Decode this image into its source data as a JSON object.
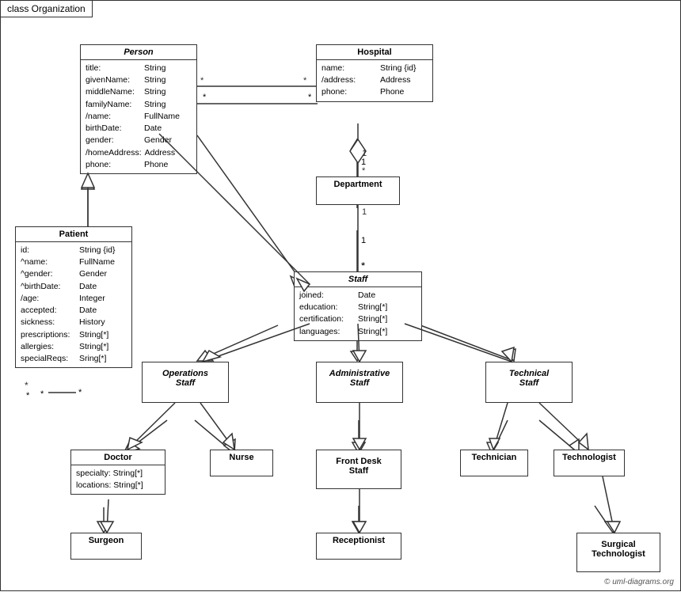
{
  "title": "class Organization",
  "copyright": "© uml-diagrams.org",
  "classes": {
    "person": {
      "name": "Person",
      "italic": true,
      "attrs": [
        [
          "title:",
          "String"
        ],
        [
          "givenName:",
          "String"
        ],
        [
          "middleName:",
          "String"
        ],
        [
          "familyName:",
          "String"
        ],
        [
          "/name:",
          "FullName"
        ],
        [
          "birthDate:",
          "Date"
        ],
        [
          "gender:",
          "Gender"
        ],
        [
          "/homeAddress:",
          "Address"
        ],
        [
          "phone:",
          "Phone"
        ]
      ]
    },
    "hospital": {
      "name": "Hospital",
      "italic": false,
      "attrs": [
        [
          "name:",
          "String {id}"
        ],
        [
          "/address:",
          "Address"
        ],
        [
          "phone:",
          "Phone"
        ]
      ]
    },
    "patient": {
      "name": "Patient",
      "italic": false,
      "attrs": [
        [
          "id:",
          "String {id}"
        ],
        [
          "^name:",
          "FullName"
        ],
        [
          "^gender:",
          "Gender"
        ],
        [
          "^birthDate:",
          "Date"
        ],
        [
          "/age:",
          "Integer"
        ],
        [
          "accepted:",
          "Date"
        ],
        [
          "sickness:",
          "History"
        ],
        [
          "prescriptions:",
          "String[*]"
        ],
        [
          "allergies:",
          "String[*]"
        ],
        [
          "specialReqs:",
          "Sring[*]"
        ]
      ]
    },
    "department": {
      "name": "Department",
      "italic": false,
      "attrs": []
    },
    "staff": {
      "name": "Staff",
      "italic": true,
      "attrs": [
        [
          "joined:",
          "Date"
        ],
        [
          "education:",
          "String[*]"
        ],
        [
          "certification:",
          "String[*]"
        ],
        [
          "languages:",
          "String[*]"
        ]
      ]
    },
    "operations_staff": {
      "name": "Operations\nStaff",
      "italic": true,
      "attrs": []
    },
    "administrative_staff": {
      "name": "Administrative\nStaff",
      "italic": true,
      "attrs": []
    },
    "technical_staff": {
      "name": "Technical\nStaff",
      "italic": true,
      "attrs": []
    },
    "doctor": {
      "name": "Doctor",
      "italic": false,
      "attrs": [
        [
          "specialty:",
          "String[*]"
        ],
        [
          "locations:",
          "String[*]"
        ]
      ]
    },
    "nurse": {
      "name": "Nurse",
      "italic": false,
      "attrs": []
    },
    "front_desk_staff": {
      "name": "Front Desk\nStaff",
      "italic": false,
      "attrs": []
    },
    "technician": {
      "name": "Technician",
      "italic": false,
      "attrs": []
    },
    "technologist": {
      "name": "Technologist",
      "italic": false,
      "attrs": []
    },
    "surgeon": {
      "name": "Surgeon",
      "italic": false,
      "attrs": []
    },
    "receptionist": {
      "name": "Receptionist",
      "italic": false,
      "attrs": []
    },
    "surgical_technologist": {
      "name": "Surgical\nTechnologist",
      "italic": false,
      "attrs": []
    }
  }
}
